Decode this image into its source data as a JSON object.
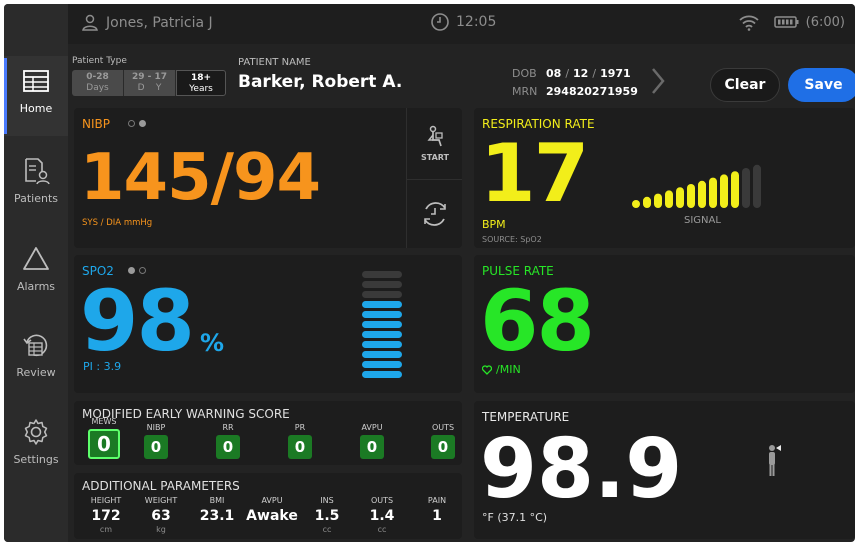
{
  "topbar": {
    "user": "Jones, Patricia J",
    "time": "12:05",
    "battery": "(6:00)"
  },
  "sidebar": {
    "items": [
      {
        "label": "Home",
        "icon": "table-icon"
      },
      {
        "label": "Patients",
        "icon": "patient-list-icon"
      },
      {
        "label": "Alarms",
        "icon": "alarm-triangle-icon"
      },
      {
        "label": "Review",
        "icon": "review-history-icon"
      },
      {
        "label": "Settings",
        "icon": "gear-icon"
      }
    ]
  },
  "patient": {
    "type_label": "Patient Type",
    "types": [
      {
        "top": "0-28",
        "bottom": "Days"
      },
      {
        "top": "29 - 17",
        "bottom": "D    Y"
      },
      {
        "top": "18+",
        "bottom": "Years",
        "selected": true
      }
    ],
    "name_label": "PATIENT NAME",
    "name": "Barker, Robert A.",
    "dob_label": "DOB",
    "dob_month": "08",
    "dob_day": "12",
    "dob_year": "1971",
    "mrn_label": "MRN",
    "mrn": "294820271959"
  },
  "buttons": {
    "clear": "Clear",
    "save": "Save"
  },
  "nibp": {
    "title": "NIBP",
    "value": "145/94",
    "unit": "SYS / DIA mmHg",
    "start": "START",
    "color": "#f7941d"
  },
  "resp": {
    "title": "RESPIRATION RATE",
    "value": "17",
    "unit": "BPM",
    "source": "SOURCE: SpO2",
    "signal": "SIGNAL",
    "signal_level": 0.8,
    "color": "#f2ee1a"
  },
  "spo2": {
    "title": "SPO2",
    "value": "98",
    "unit": "%",
    "pi": "PI : 3.9",
    "perfusion_level": 0.7,
    "color": "#1ea7ea"
  },
  "pulse": {
    "title": "PULSE RATE",
    "value": "68",
    "unit": "/MIN",
    "color": "#27e627"
  },
  "mews": {
    "title": "MODIFIED EARLY WARNING SCORE",
    "items": [
      {
        "label": "MEWS",
        "value": "0"
      },
      {
        "label": "NIBP",
        "value": "0"
      },
      {
        "label": "RR",
        "value": "0"
      },
      {
        "label": "PR",
        "value": "0"
      },
      {
        "label": "AVPU",
        "value": "0"
      },
      {
        "label": "OUTS",
        "value": "0"
      }
    ]
  },
  "additional": {
    "title": "ADDITIONAL PARAMETERS",
    "items": [
      {
        "label": "HEIGHT",
        "value": "172",
        "unit": "cm"
      },
      {
        "label": "WEIGHT",
        "value": "63",
        "unit": "kg"
      },
      {
        "label": "BMI",
        "value": "23.1",
        "unit": ""
      },
      {
        "label": "AVPU",
        "value": "Awake",
        "unit": ""
      },
      {
        "label": "INS",
        "value": "1.5",
        "unit": "cc"
      },
      {
        "label": "OUTS",
        "value": "1.4",
        "unit": "cc"
      },
      {
        "label": "PAIN",
        "value": "1",
        "unit": ""
      }
    ]
  },
  "temperature": {
    "title": "TEMPERATURE",
    "value": "98.9",
    "unit": "°F (37.1 °C)"
  }
}
